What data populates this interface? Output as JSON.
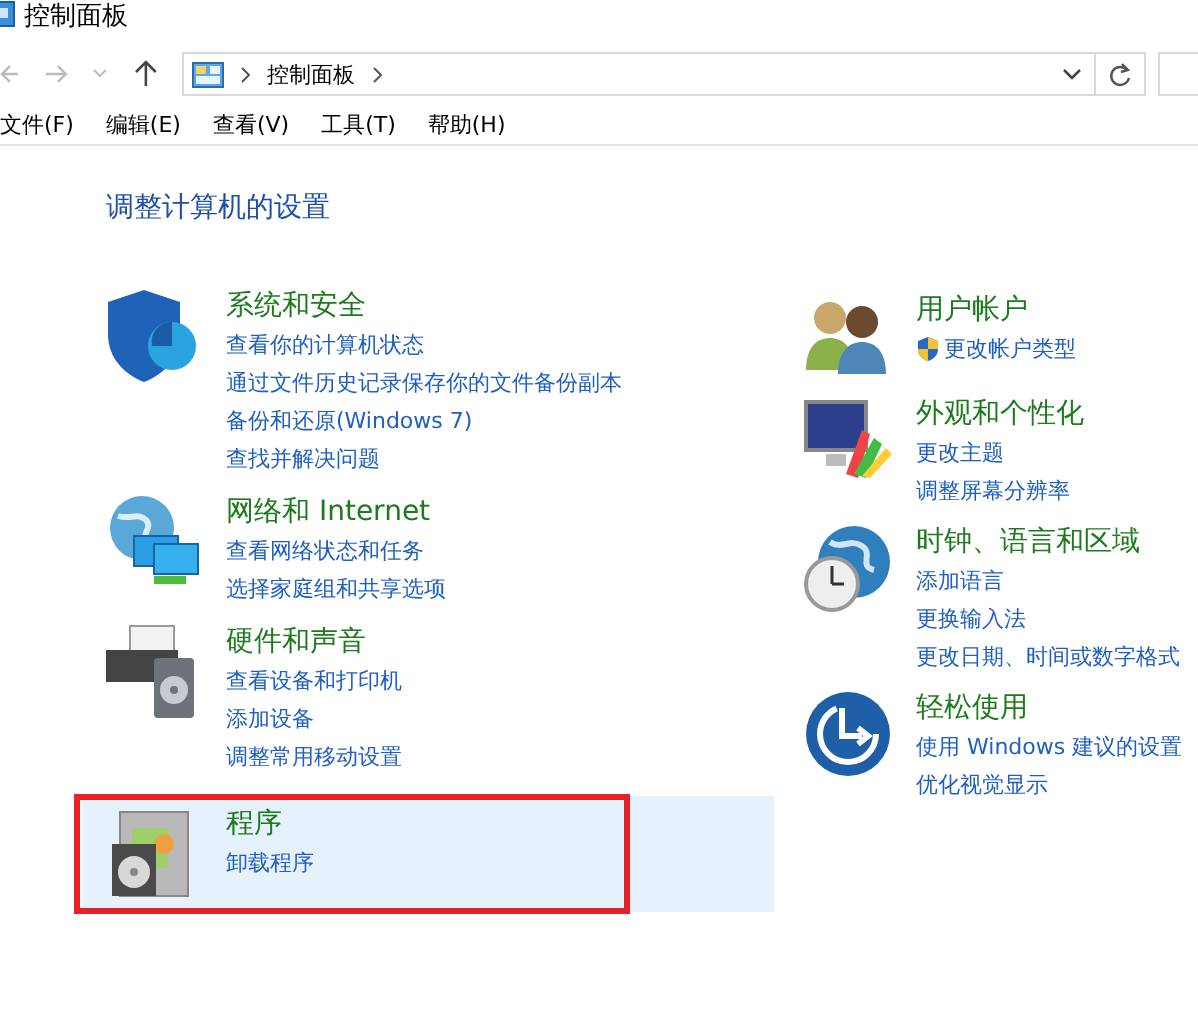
{
  "window": {
    "title": "控制面板"
  },
  "address_bar": {
    "path": [
      "控制面板"
    ]
  },
  "menu": [
    "文件(F)",
    "编辑(E)",
    "查看(V)",
    "工具(T)",
    "帮助(H)"
  ],
  "heading": "调整计算机的设置",
  "left_categories": [
    {
      "title": "系统和安全",
      "hovered": false,
      "marked": false,
      "links": [
        {
          "text": "查看你的计算机状态",
          "shield": false
        },
        {
          "text": "通过文件历史记录保存你的文件备份副本",
          "shield": false
        },
        {
          "text": "备份和还原(Windows 7)",
          "shield": false
        },
        {
          "text": "查找并解决问题",
          "shield": false
        }
      ]
    },
    {
      "title": "网络和 Internet",
      "hovered": false,
      "marked": false,
      "links": [
        {
          "text": "查看网络状态和任务",
          "shield": false
        },
        {
          "text": "选择家庭组和共享选项",
          "shield": false
        }
      ]
    },
    {
      "title": "硬件和声音",
      "hovered": false,
      "marked": false,
      "links": [
        {
          "text": "查看设备和打印机",
          "shield": false
        },
        {
          "text": "添加设备",
          "shield": false
        },
        {
          "text": "调整常用移动设置",
          "shield": false
        }
      ]
    },
    {
      "title": "程序",
      "hovered": true,
      "marked": true,
      "links": [
        {
          "text": "卸载程序",
          "shield": false
        }
      ]
    }
  ],
  "right_categories": [
    {
      "title": "用户帐户",
      "links": [
        {
          "text": "更改帐户类型",
          "shield": true
        }
      ]
    },
    {
      "title": "外观和个性化",
      "links": [
        {
          "text": "更改主题",
          "shield": false
        },
        {
          "text": "调整屏幕分辨率",
          "shield": false
        }
      ]
    },
    {
      "title": "时钟、语言和区域",
      "links": [
        {
          "text": "添加语言",
          "shield": false
        },
        {
          "text": "更换输入法",
          "shield": false
        },
        {
          "text": "更改日期、时间或数字格式",
          "shield": false
        }
      ]
    },
    {
      "title": "轻松使用",
      "links": [
        {
          "text": "使用 Windows 建议的设置",
          "shield": false
        },
        {
          "text": "优化视觉显示",
          "shield": false
        }
      ]
    }
  ]
}
